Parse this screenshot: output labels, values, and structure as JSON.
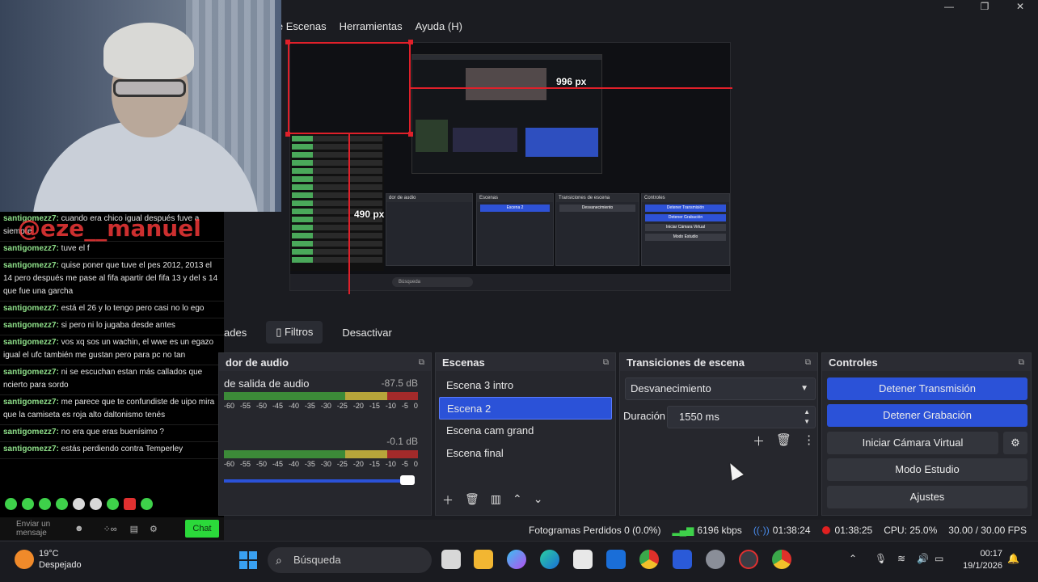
{
  "menu": {
    "items": [
      "le Escenas",
      "Herramientas",
      "Ayuda (H)"
    ]
  },
  "window_controls": [
    "—",
    "❐",
    "✕"
  ],
  "preview": {
    "measure_width": "996 px",
    "measure_height": "490 px",
    "nested_search": "Búsqueda"
  },
  "watermark": "@eze__manuel",
  "chat": {
    "messages": [
      {
        "user": "santigomezz7:",
        "text": " cuando era chico igual después fuve a siempre"
      },
      {
        "user": "santigomezz7:",
        "text": " tuve el f"
      },
      {
        "user": "santigomezz7:",
        "text": " quise poner que tuve el pes 2012, 2013 el 14 pero después me pase al fifa apartir del fifa 13 y del s 14 que fue una garcha"
      },
      {
        "user": "santigomezz7:",
        "text": " está el 26 y lo tengo pero casi no lo ego"
      },
      {
        "user": "santigomezz7:",
        "text": " si pero ni lo jugaba desde antes"
      },
      {
        "user": "santigomezz7:",
        "text": " vos xq sos un wachin, el wwe es un egazo igual el ufc también me gustan pero para pc no tan"
      },
      {
        "user": "santigomezz7:",
        "text": " ni se escuchan estan más callados que ncierto para sordo"
      },
      {
        "user": "santigomezz7:",
        "text": " me parece que te confundiste de uipo mira que la camiseta es roja alto daltonismo tenés"
      },
      {
        "user": "santigomezz7:",
        "text": " no era que eras buenísimo ?"
      },
      {
        "user": "santigomezz7:",
        "text": " estás perdiendo contra Temperley"
      }
    ],
    "input_placeholder": "Enviar un mensaje",
    "send_label": "Chat"
  },
  "tabs": {
    "properties": "ades",
    "filters": "Filtros",
    "deactivate": "Desactivar"
  },
  "audio_mixer": {
    "title": "dor de audio",
    "channel1_name": "de salida de audio",
    "channel1_db": "-87.5 dB",
    "channel2_db": "-0.1 dB",
    "ticks": [
      "-60",
      "-55",
      "-50",
      "-45",
      "-40",
      "-35",
      "-30",
      "-25",
      "-20",
      "-15",
      "-10",
      "-5",
      "0"
    ]
  },
  "scenes": {
    "title": "Escenas",
    "items": [
      "Escena 3 intro",
      "Escena 2",
      "Escena cam grand",
      "Escena  final"
    ],
    "active_index": 1
  },
  "transitions": {
    "title": "Transiciones de escena",
    "selected": "Desvanecimiento",
    "duration_label": "Duración",
    "duration_value": "1550 ms"
  },
  "controls": {
    "title": "Controles",
    "stop_stream": "Detener Transmisión",
    "stop_record": "Detener Grabación",
    "virtual_cam": "Iniciar Cámara Virtual",
    "studio_mode": "Modo Estudio",
    "settings": "Ajustes"
  },
  "status": {
    "dropped_frames": "Fotogramas Perdidos 0 (0.0%)",
    "bitrate": "6196 kbps",
    "stream_time": "01:38:24",
    "record_time": "01:38:25",
    "cpu": "CPU: 25.0%",
    "fps": "30.00 / 30.00 FPS"
  },
  "taskbar": {
    "temperature": "19°C",
    "weather": "Despejado",
    "search": "Búsqueda",
    "time": "00:17",
    "date": "19/1/2026"
  },
  "colors": {
    "accent": "#2b52d8",
    "green": "#3ed14a",
    "red": "#e0202a",
    "bg": "#1b1c21"
  }
}
